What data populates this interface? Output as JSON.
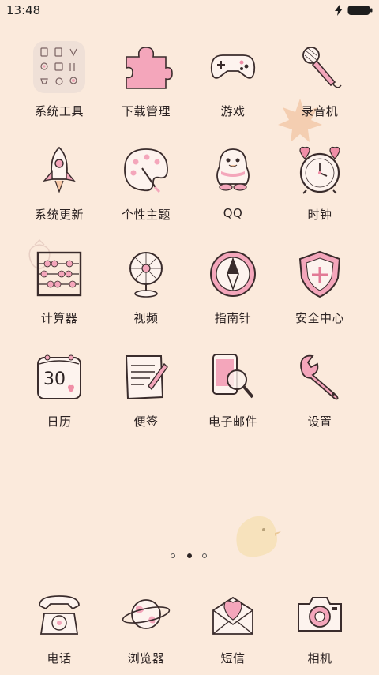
{
  "status_bar": {
    "time": "13:48"
  },
  "apps": [
    {
      "label": "系统工具",
      "icon": "tools-folder-icon"
    },
    {
      "label": "下载管理",
      "icon": "puzzle-icon"
    },
    {
      "label": "游戏",
      "icon": "gamepad-icon"
    },
    {
      "label": "录音机",
      "icon": "microphone-icon"
    },
    {
      "label": "系统更新",
      "icon": "rocket-icon"
    },
    {
      "label": "个性主题",
      "icon": "palette-icon"
    },
    {
      "label": "QQ",
      "icon": "penguin-icon"
    },
    {
      "label": "时钟",
      "icon": "alarm-clock-icon"
    },
    {
      "label": "计算器",
      "icon": "abacus-icon"
    },
    {
      "label": "视频",
      "icon": "fan-icon"
    },
    {
      "label": "指南针",
      "icon": "compass-icon"
    },
    {
      "label": "安全中心",
      "icon": "shield-icon"
    },
    {
      "label": "日历",
      "icon": "calendar-icon",
      "day": "30"
    },
    {
      "label": "便签",
      "icon": "notepad-icon"
    },
    {
      "label": "电子邮件",
      "icon": "phone-magnifier-icon"
    },
    {
      "label": "设置",
      "icon": "wrench-icon"
    }
  ],
  "page_indicator": {
    "total": 3,
    "active": 2
  },
  "dock": [
    {
      "label": "电话",
      "icon": "rotary-phone-icon"
    },
    {
      "label": "浏览器",
      "icon": "planet-icon"
    },
    {
      "label": "短信",
      "icon": "envelope-heart-icon"
    },
    {
      "label": "相机",
      "icon": "camera-icon"
    }
  ],
  "colors": {
    "background": "#fbeadc",
    "accent_pink": "#f5a3b7",
    "ink": "#2c2424"
  }
}
